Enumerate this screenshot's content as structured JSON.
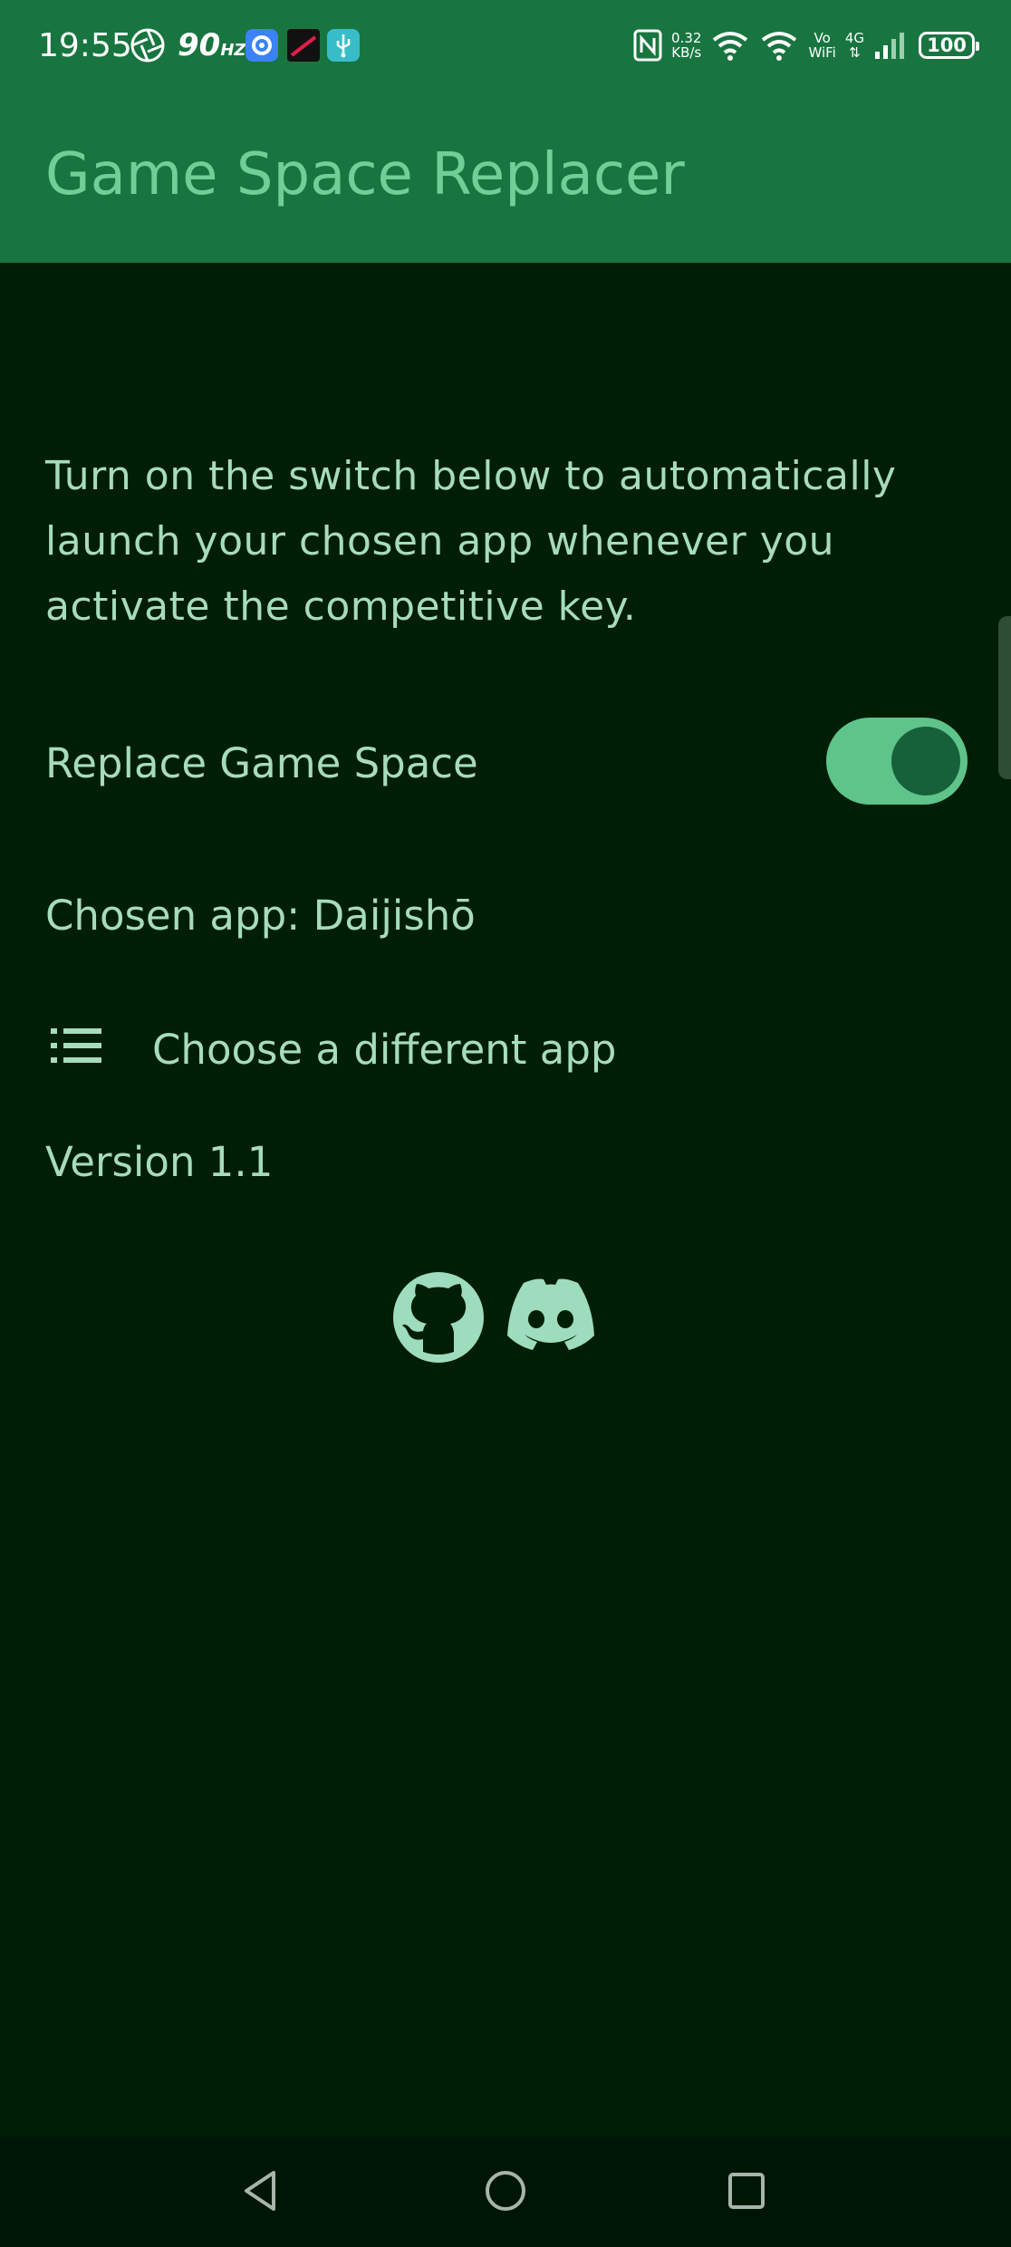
{
  "status_bar": {
    "time": "19:55",
    "refresh_rate": "90",
    "refresh_unit": "HZ",
    "net_speed_value": "0.32",
    "net_speed_unit": "KB/s",
    "volte_top": "Vo",
    "volte_bottom": "WiFi",
    "network": "4G",
    "battery": "100"
  },
  "app_bar": {
    "title": "Game Space Replacer"
  },
  "main": {
    "description": "Turn on the switch below to automatically launch your chosen app whenever you activate the competitive key.",
    "switch_label": "Replace Game Space",
    "switch_on": true,
    "chosen_app": "Chosen app: Daijishō",
    "choose_button": "Choose a different app",
    "version": "Version 1.1",
    "links": [
      "github-icon",
      "discord-icon"
    ]
  },
  "colors": {
    "background": "#001e05",
    "app_bar": "#187540",
    "accent": "#5ec48a",
    "text": "#a6dcba"
  }
}
